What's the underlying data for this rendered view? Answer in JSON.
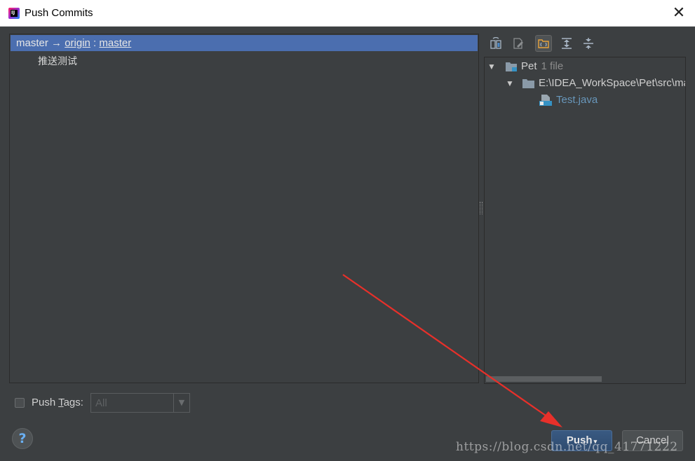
{
  "window": {
    "title": "Push Commits",
    "close_glyph": "✕"
  },
  "app_icon": {
    "name": "intellij-idea-icon",
    "glyph": "IJ"
  },
  "branch": {
    "local": "master",
    "arrow": "→",
    "remote": "origin",
    "separator": ":",
    "remote_branch": "master",
    "highlight_color": "#4b6eaf"
  },
  "commits": [
    {
      "message": "推送测试"
    }
  ],
  "toolbar": {
    "buttons": [
      {
        "name": "show-diff-icon"
      },
      {
        "name": "edit-source-icon"
      },
      {
        "name": "group-by-directory-icon",
        "active": true
      },
      {
        "name": "expand-all-icon"
      },
      {
        "name": "collapse-all-icon"
      }
    ]
  },
  "tree": {
    "project": {
      "name": "Pet",
      "count": "1 file"
    },
    "folder": {
      "path": "E:\\IDEA_WorkSpace\\Pet\\src\\main"
    },
    "file": {
      "name": "Test.java",
      "color": "#6897bb"
    }
  },
  "push_tags": {
    "label_prefix": "Push ",
    "label_mnemonic": "T",
    "label_suffix": "ags:",
    "checked": false,
    "select_value": "All",
    "select_arrow": "▼"
  },
  "buttons": {
    "help": "?",
    "push": "Push",
    "push_caret": "▾",
    "cancel": "Cancel"
  },
  "watermark": "https://blog.csdn.net/qq_41771222",
  "annotation": {
    "color": "#e8302a"
  }
}
